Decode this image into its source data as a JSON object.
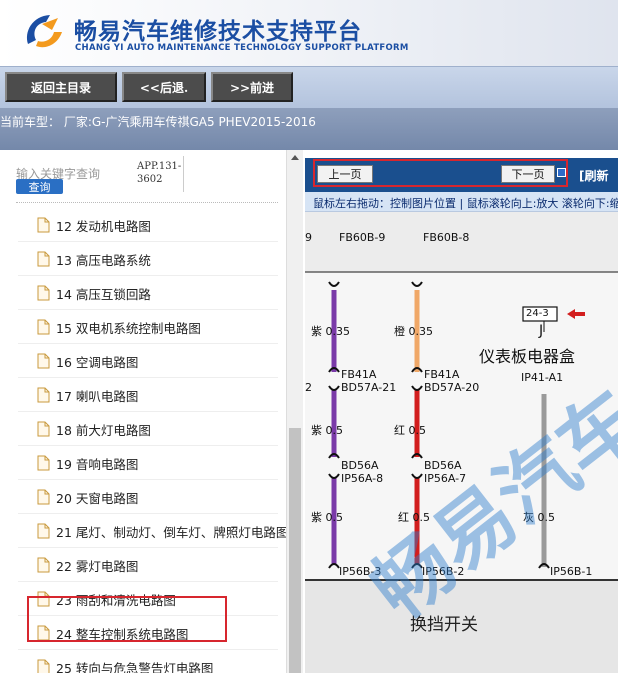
{
  "header": {
    "brand_cn": "畅易汽车维修技术支持平台",
    "brand_en": "CHANG YI AUTO MAINTENANCE TECHNOLOGY SUPPORT PLATFORM",
    "logo_icon": "cy-logo-icon"
  },
  "toolbar": {
    "home": "返回主目录",
    "back": "<<后退.",
    "forward": ">>前进"
  },
  "model": {
    "text": "当前车型：  厂家:G-广汽乘用车传祺GA5 PHEV2015-2016"
  },
  "sidebar": {
    "search_placeholder": "输入关键字查询",
    "search_button": "查询",
    "app_code_line1": "APP.131-",
    "app_code_line2": "3602",
    "items": [
      {
        "label": "12 发动机电路图"
      },
      {
        "label": "13 高压电路系统"
      },
      {
        "label": "14 高压互锁回路"
      },
      {
        "label": "15 双电机系统控制电路图"
      },
      {
        "label": "16 空调电路图"
      },
      {
        "label": "17 喇叭电路图"
      },
      {
        "label": "18 前大灯电路图"
      },
      {
        "label": "19 音响电路图"
      },
      {
        "label": "20 天窗电路图"
      },
      {
        "label": "21 尾灯、制动灯、倒车灯、牌照灯电路图"
      },
      {
        "label": "22 雾灯电路图"
      },
      {
        "label": "23 雨刮和清洗电路图"
      },
      {
        "label": "24 整车控制系统电路图"
      },
      {
        "label": "25 转向与危急警告灯电路图"
      }
    ]
  },
  "viewer": {
    "prev_page": "上一页",
    "next_page": "下一页",
    "refresh": "[刷新",
    "hint": "鼠标左右拖动：控制图片位置 | 鼠标滚轮向上:放大  滚轮向下:缩小",
    "diagram": {
      "title": "仪表板电器盒",
      "ref_box": "24-3",
      "ref_letter": "J",
      "module": "IP41-A1",
      "labels": {
        "c1_top": "FB60B-9",
        "c2_top": "FB60B-8",
        "w1_a": "紫 0.35",
        "w2_a": "橙 0.35",
        "c1_mid_a": "FB41A",
        "c1_mid_b": "BD57A-21",
        "c2_mid_a": "FB41A",
        "c2_mid_b": "BD57A-20",
        "w1_b": "紫 0.5",
        "w2_b": "红 0.5",
        "c1_low_a": "BD56A",
        "c1_low_b": "IP56A-8",
        "c2_low_a": "BD56A",
        "c2_low_b": "IP56A-7",
        "w1_c": "紫 0.5",
        "w2_c": "红 0.5",
        "w3_c": "灰 0.5",
        "c1_bot": "IP56B-3",
        "c2_bot": "IP56B-2",
        "c3_bot": "IP56B-1",
        "left_edge_9": "9",
        "left_edge_2": "2"
      },
      "switch": "换挡开关",
      "watermark": "畅易汽车"
    }
  }
}
